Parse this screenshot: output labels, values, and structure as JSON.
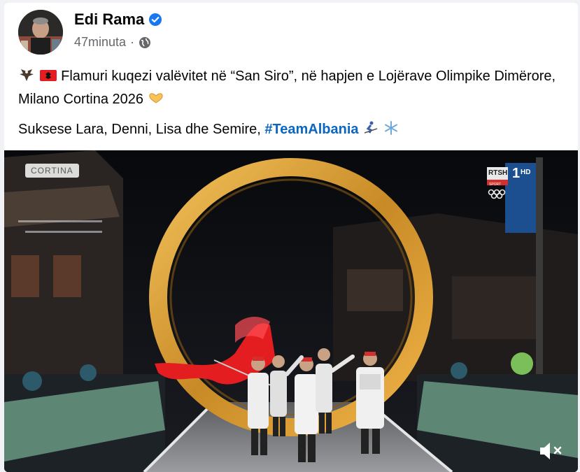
{
  "post": {
    "author": "Edi Rama",
    "time": "47minuta",
    "separator": "·",
    "line1_text": "Flamuri kuqezi valëvitet në “San Siro”, në hapjen e Lojërave Olimpike Dimërore, Milano Cortina 2026",
    "line2_text": "Suksese Lara, Denni, Lisa dhe Semire, ",
    "hashtag": "#TeamAlbania"
  },
  "video": {
    "location_label": "CORTINA",
    "channel_label": "RTSH",
    "channel_number": "1",
    "channel_hd": "HD",
    "channel_sub": "SPORT"
  },
  "icons": {
    "verified": "verified-badge-icon",
    "audience": "globe-icon",
    "mute": "speaker-muted-icon"
  },
  "colors": {
    "link": "#0a66c2",
    "verified": "#1877f2",
    "flag_red": "#e41e20"
  }
}
